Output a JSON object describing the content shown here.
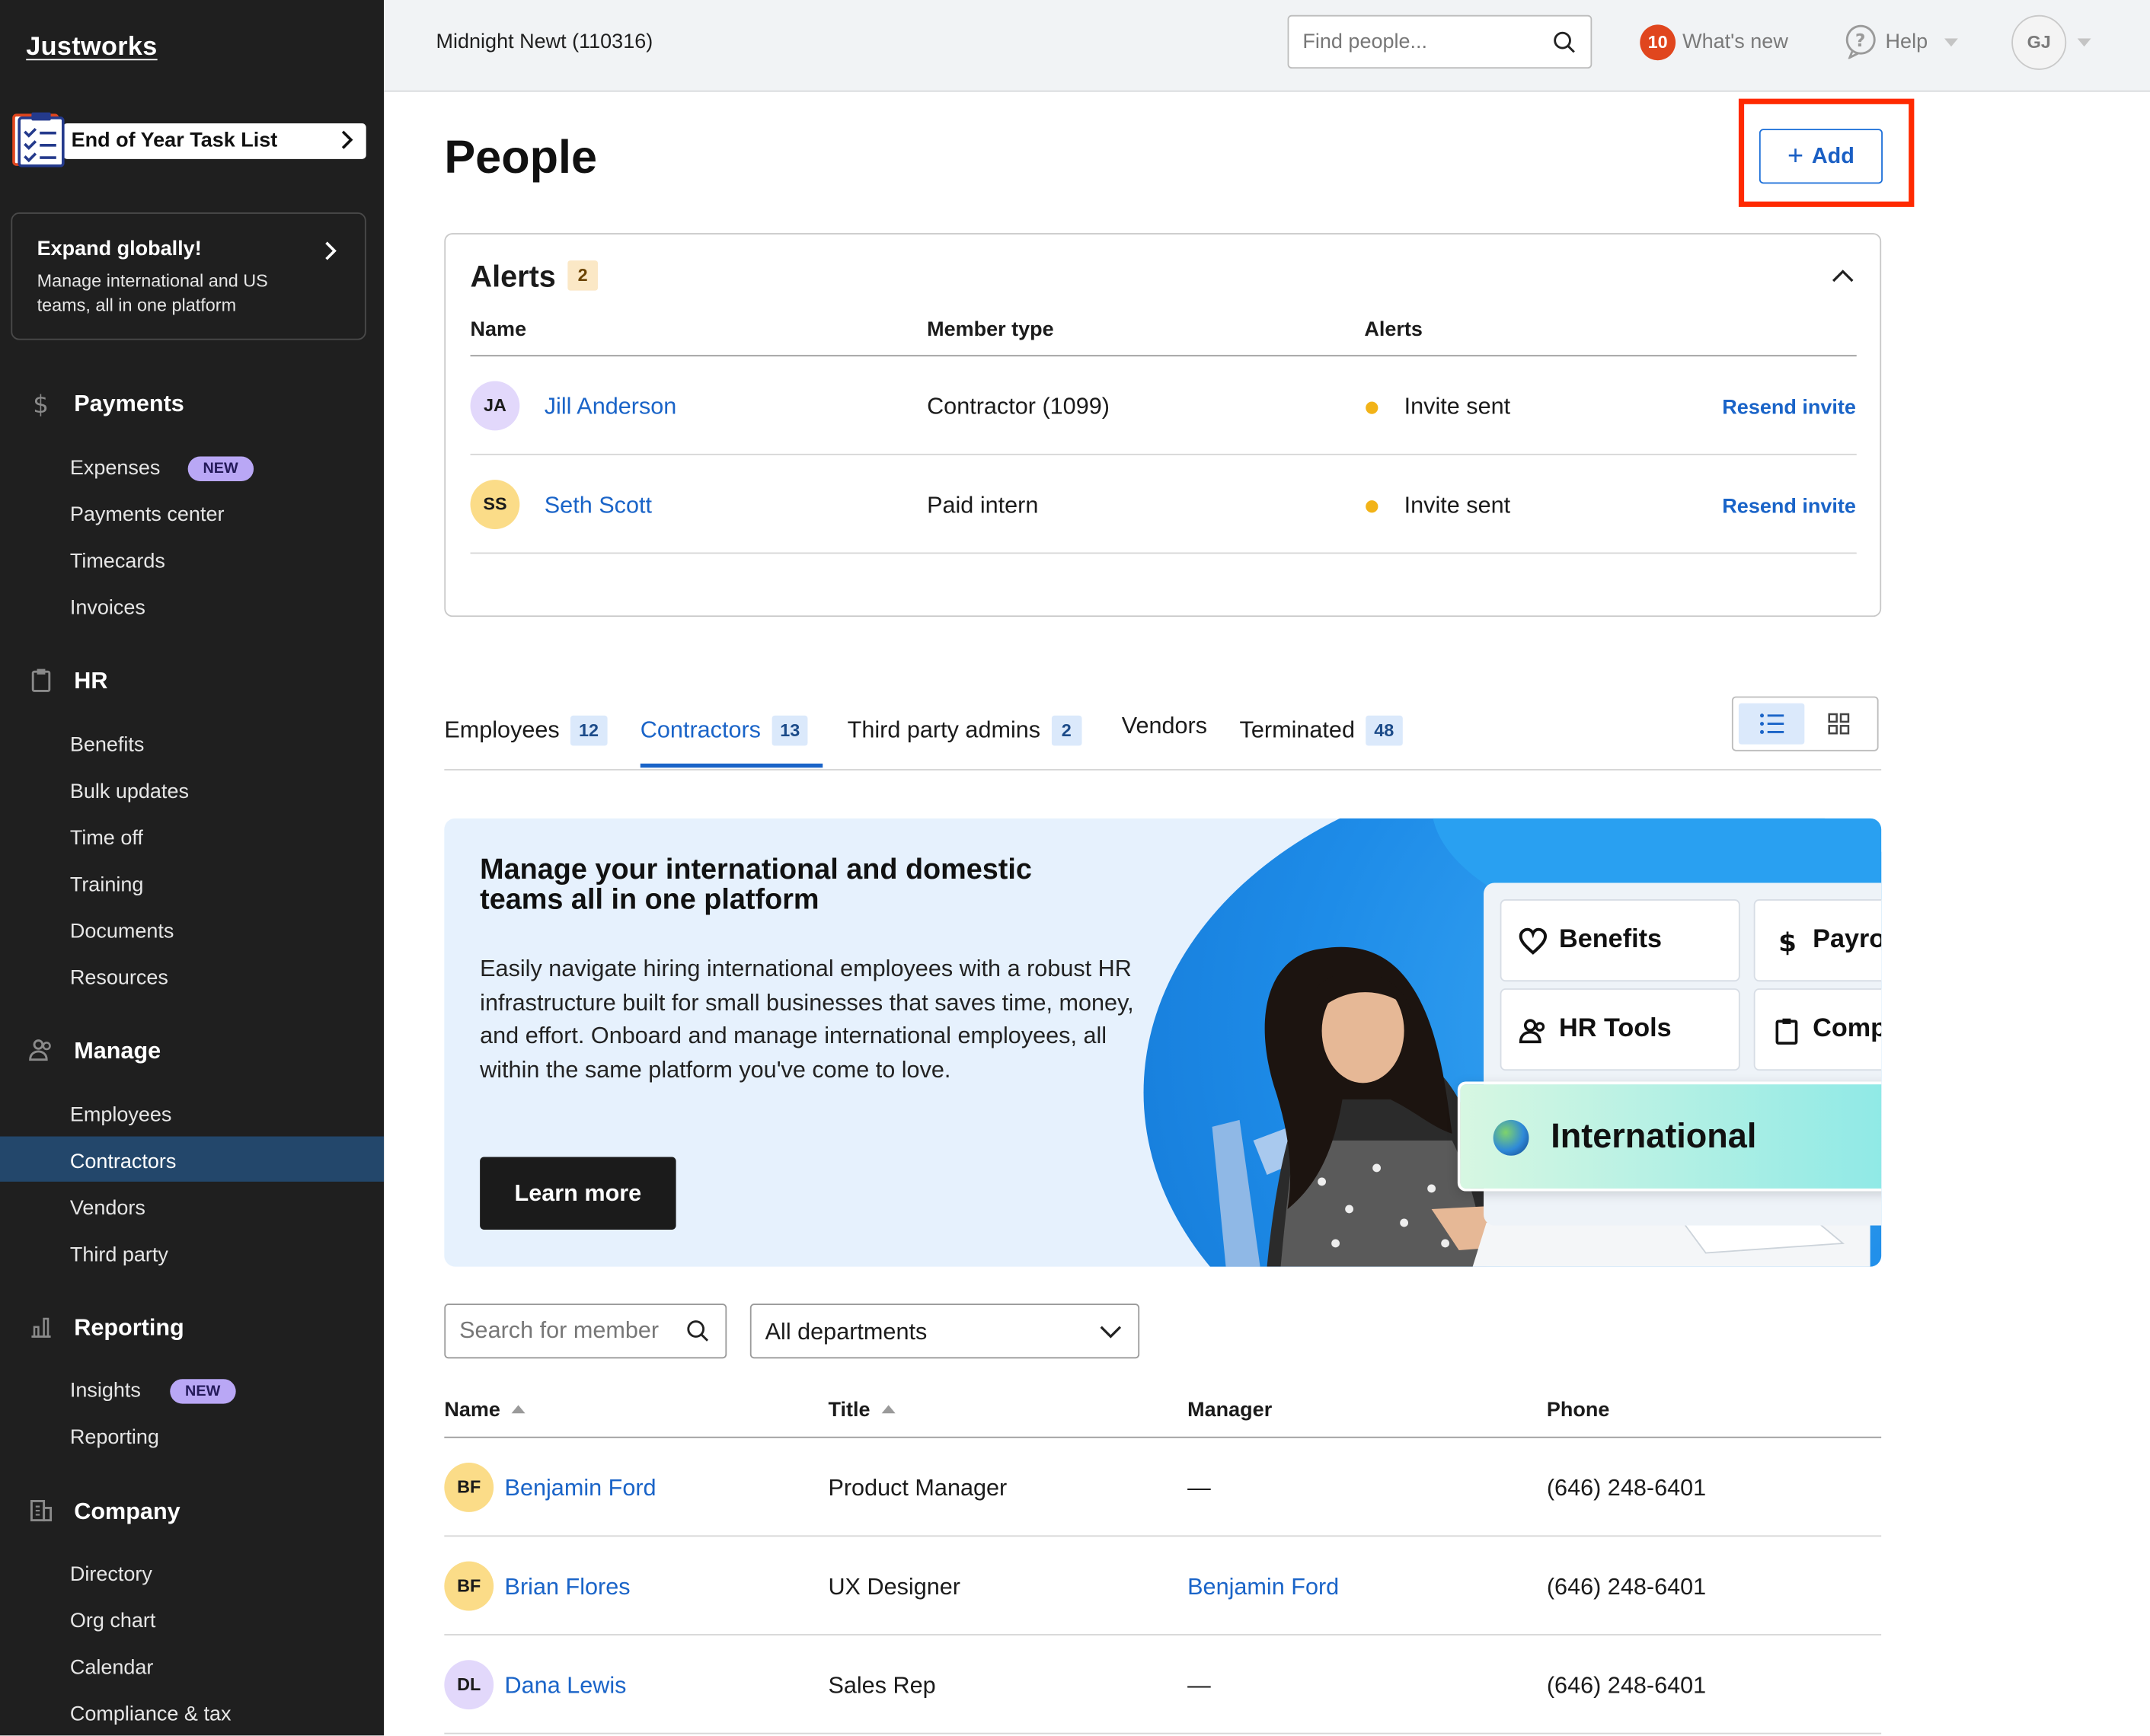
{
  "sidebar": {
    "logo": "Justworks",
    "task_list": "End of Year Task List",
    "expand": {
      "title": "Expand globally!",
      "description": "Manage international and US teams, all in one platform"
    },
    "sections": {
      "payments": {
        "title": "Payments",
        "items": [
          "Expenses",
          "Payments center",
          "Timecards",
          "Invoices"
        ],
        "badge": "NEW"
      },
      "hr": {
        "title": "HR",
        "items": [
          "Benefits",
          "Bulk updates",
          "Time off",
          "Training",
          "Documents",
          "Resources"
        ]
      },
      "manage": {
        "title": "Manage",
        "items": [
          "Employees",
          "Contractors",
          "Vendors",
          "Third party"
        ],
        "active": "Contractors"
      },
      "reporting": {
        "title": "Reporting",
        "items": [
          "Insights",
          "Reporting"
        ],
        "badge": "NEW"
      },
      "company": {
        "title": "Company",
        "items": [
          "Directory",
          "Org chart",
          "Calendar",
          "Compliance & tax"
        ]
      }
    }
  },
  "topbar": {
    "company": "Midnight Newt (110316)",
    "search_placeholder": "Find people...",
    "whats_new_count": "10",
    "whats_new_label": "What's new",
    "help_label": "Help",
    "user_initials": "GJ"
  },
  "page": {
    "title": "People",
    "add_label": "Add"
  },
  "alerts": {
    "title": "Alerts",
    "count": "2",
    "columns": [
      "Name",
      "Member type",
      "Alerts"
    ],
    "rows": [
      {
        "initials": "JA",
        "name": "Jill Anderson",
        "type": "Contractor (1099)",
        "alert": "Invite sent",
        "action": "Resend invite"
      },
      {
        "initials": "SS",
        "name": "Seth Scott",
        "type": "Paid intern",
        "alert": "Invite sent",
        "action": "Resend invite"
      }
    ]
  },
  "tabs": [
    {
      "label": "Employees",
      "count": "12"
    },
    {
      "label": "Contractors",
      "count": "13"
    },
    {
      "label": "Third party admins",
      "count": "2"
    },
    {
      "label": "Vendors"
    },
    {
      "label": "Terminated",
      "count": "48"
    }
  ],
  "promo": {
    "headline": "Manage your international and domestic teams all in one platform",
    "body": "Easily navigate hiring international employees with a robust HR infrastructure built for small businesses that saves time, money, and effort. Onboard and manage international employees, all within the same platform you've come to love.",
    "button": "Learn more",
    "features": [
      "Benefits",
      "Payro",
      "HR Tools",
      "Comp"
    ],
    "highlight": "International"
  },
  "filters": {
    "search_placeholder": "Search for member",
    "department": "All departments"
  },
  "table": {
    "columns": [
      "Name",
      "Title",
      "Manager",
      "Phone"
    ],
    "rows": [
      {
        "initials": "BF",
        "name": "Benjamin Ford",
        "title": "Product Manager",
        "manager": "—",
        "phone": "(646) 248-6401"
      },
      {
        "initials": "BF",
        "name": "Brian Flores",
        "title": "UX Designer",
        "manager": "Benjamin Ford",
        "phone": "(646) 248-6401"
      },
      {
        "initials": "DL",
        "name": "Dana Lewis",
        "title": "Sales Rep",
        "manager": "—",
        "phone": "(646) 248-6401"
      }
    ]
  },
  "colors": {
    "sidebar_bg": "#1f1f1f",
    "sidebar_active": "#23476b",
    "link_blue": "#1a64c8",
    "alert_dot": "#f2b318",
    "highlight_box": "#ff2a00",
    "promo_bg": "#e6f1fd"
  },
  "icons": [
    "task-list-icon",
    "chevron-right-icon",
    "dollar-icon",
    "clipboard-icon",
    "people-icon",
    "bar-chart-icon",
    "building-icon",
    "search-icon",
    "help-icon",
    "chevron-down-icon",
    "chevron-up-icon",
    "plus-icon",
    "list-view-icon",
    "grid-view-icon",
    "heart-icon",
    "globe-icon"
  ]
}
